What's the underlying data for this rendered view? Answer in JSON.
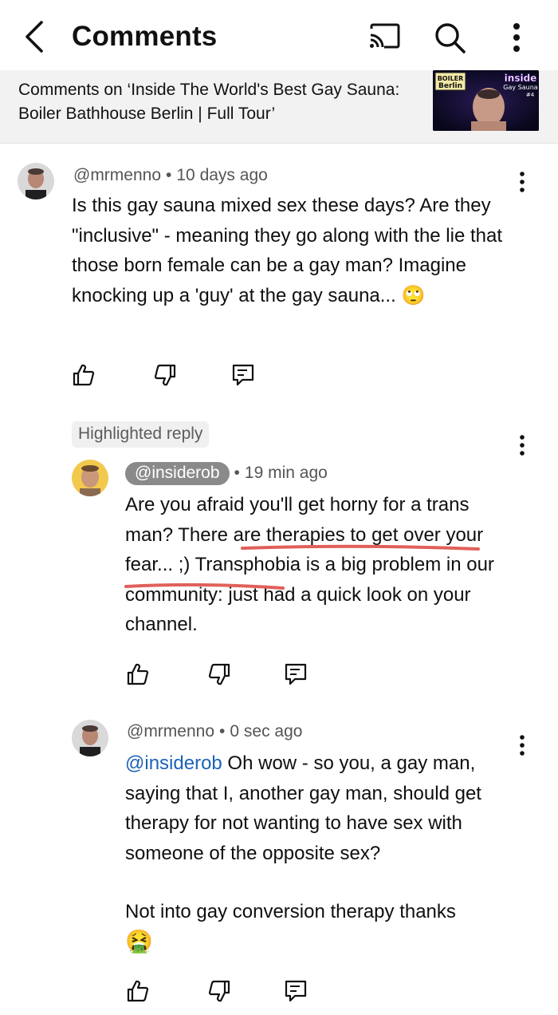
{
  "header": {
    "title": "Comments",
    "icons": [
      "back-chevron-icon",
      "cast-icon",
      "search-icon",
      "more-vertical-icon"
    ]
  },
  "video": {
    "caption": "Comments on ‘Inside The World's Best Gay Sauna: Boiler Bathhouse Berlin | Full Tour’",
    "thumb_text_left": "BOILER Berlin",
    "thumb_text_right": "inside Gay Sauna #4"
  },
  "comments": [
    {
      "author": "@mrmenno",
      "time": "10 days ago",
      "text": "Is this gay sauna mixed sex these days? Are they \"inclusive\" - meaning they go along with the lie that those born female can be a gay man? Imagine knocking up a 'guy' at the gay sauna... 🙄"
    }
  ],
  "highlighted_label": "Highlighted reply",
  "replies": [
    {
      "author": "@insiderob",
      "time": "19 min ago",
      "text": "Are you afraid you'll get horny for a trans man? There are therapies to get over your fear... ;) Transphobia is a big problem in our community: just had a quick look on your channel."
    },
    {
      "author": "@mrmenno",
      "time": "0 sec ago",
      "mention": "@insiderob",
      "text": " Oh wow - so you, a gay man, saying that I, another gay man, should get therapy for not wanting to have sex with someone of the opposite sex?",
      "text2": "Not into gay conversion therapy thanks",
      "emoji": "🤮"
    }
  ],
  "colors": {
    "accent_link": "#1c62b9",
    "annotation_red": "#e0605a",
    "strip_bg": "#f2f2f2"
  }
}
